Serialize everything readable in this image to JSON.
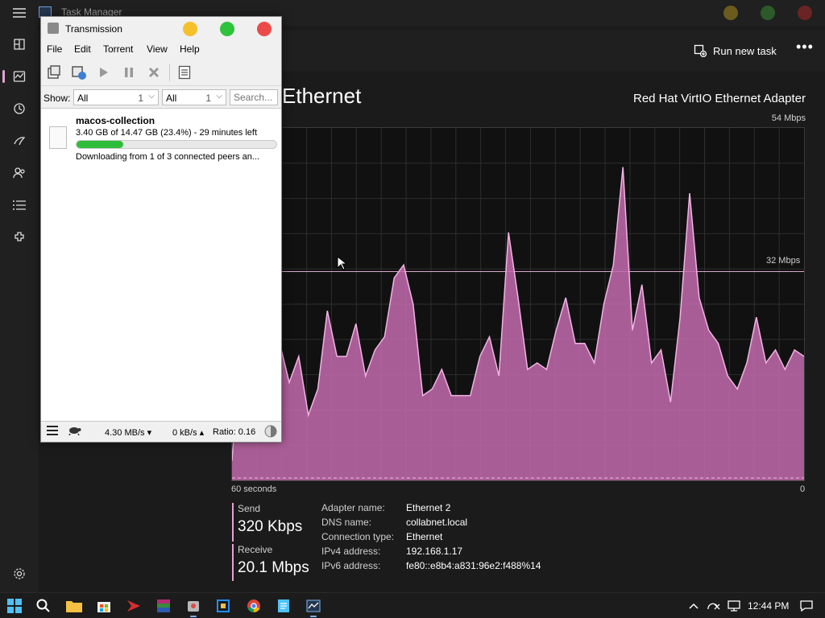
{
  "taskmanager": {
    "title": "Task Manager",
    "run_new_task": "Run new task",
    "more_label": "•••",
    "perf_title": "Ethernet",
    "adapter": "Red Hat VirtIO Ethernet Adapter",
    "max_value": "54 Mbps",
    "mid_value": "32 Mbps",
    "x_left": "60 seconds",
    "x_right": "0",
    "send_label": "Send",
    "send_value": "320 Kbps",
    "receive_label": "Receive",
    "receive_value": "20.1 Mbps",
    "properties": [
      {
        "key": "Adapter name:",
        "value": "Ethernet 2"
      },
      {
        "key": "DNS name:",
        "value": "collabnet.local"
      },
      {
        "key": "Connection type:",
        "value": "Ethernet"
      },
      {
        "key": "IPv4 address:",
        "value": "192.168.1.17"
      },
      {
        "key": "IPv6 address:",
        "value": "fe80::e8b4:a831:96e2:f488%14"
      }
    ],
    "colors": {
      "accent": "#e5a2d4",
      "send": "#e5a2d4",
      "receive": "#e5a2d4",
      "graph_fill": "#c46bae"
    },
    "nav_icons": [
      "hamburger-icon",
      "processes-icon",
      "performance-icon",
      "app-history-icon",
      "startup-apps-icon",
      "users-icon",
      "details-icon",
      "services-icon",
      "settings-icon"
    ]
  },
  "chart_data": {
    "type": "area",
    "ylabel": "",
    "ylim": [
      0,
      54
    ],
    "x": [
      60,
      59,
      58,
      57,
      56,
      55,
      54,
      53,
      52,
      51,
      50,
      49,
      48,
      47,
      46,
      45,
      44,
      43,
      42,
      41,
      40,
      39,
      38,
      37,
      36,
      35,
      34,
      33,
      32,
      31,
      30,
      29,
      28,
      27,
      26,
      25,
      24,
      23,
      22,
      21,
      20,
      19,
      18,
      17,
      16,
      15,
      14,
      13,
      12,
      11,
      10,
      9,
      8,
      7,
      6,
      5,
      4,
      3,
      2,
      1,
      0
    ],
    "series": [
      {
        "values": [
          3,
          24,
          20,
          22,
          22,
          21,
          15,
          19,
          10,
          14,
          26,
          19,
          19,
          24,
          16,
          20,
          22,
          31,
          33,
          27,
          13,
          14,
          17,
          13,
          13,
          13,
          19,
          22,
          16,
          38,
          28,
          17,
          18,
          17,
          23,
          28,
          21,
          21,
          18,
          27,
          33,
          48,
          23,
          30,
          18,
          20,
          12,
          25,
          44,
          28,
          23,
          21,
          16,
          14,
          18,
          25,
          18,
          20,
          17,
          20,
          19
        ]
      }
    ]
  },
  "transmission": {
    "title": "Transmission",
    "menu": [
      "File",
      "Edit",
      "Torrent",
      "View",
      "Help"
    ],
    "show_label": "Show:",
    "filter1": {
      "value": "All",
      "count": "1"
    },
    "filter2": {
      "value": "All",
      "count": "1"
    },
    "search_placeholder": "Search...",
    "torrent": {
      "name": "macos-collection",
      "progress_text": "3.40 GB of 14.47 GB (23.4%) - 29 minutes left",
      "progress_percent": 23.4,
      "status": "Downloading from 1 of 3 connected peers an..."
    },
    "status_bar": {
      "down_speed": "4.30 MB/s ▾",
      "up_speed": "0 kB/s ▴",
      "ratio": "Ratio: 0.16"
    }
  },
  "taskbar": {
    "clock": "12:44 PM",
    "apps": [
      "start-icon",
      "search-icon",
      "file-explorer-icon",
      "store-icon",
      "app-red-icon",
      "winrar-icon",
      "transmission-icon",
      "virtualbox-icon",
      "chrome-icon",
      "notepad-icon",
      "task-manager-icon"
    ]
  }
}
